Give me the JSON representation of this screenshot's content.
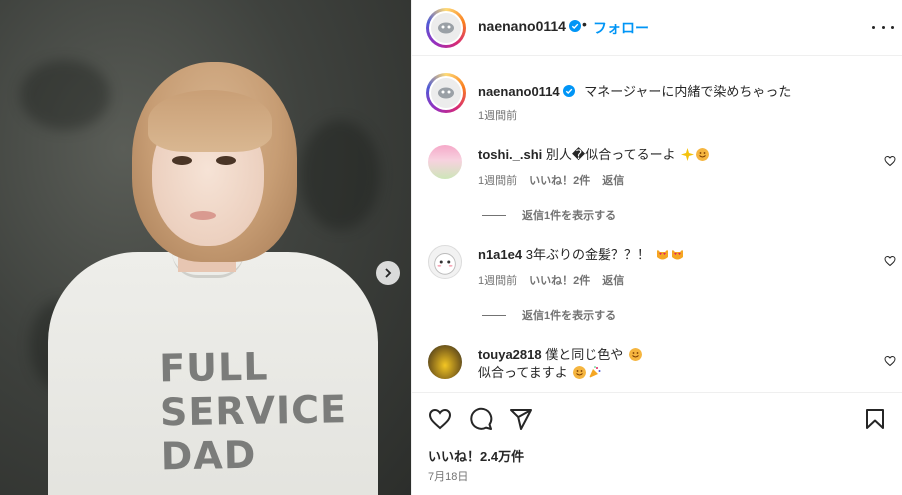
{
  "header": {
    "username": "naenano0114",
    "dot": "•",
    "follow_label": "フォロー"
  },
  "caption": {
    "username": "naenano0114",
    "text": "マネージャーに内緒で染めちゃった",
    "time": "1週間前"
  },
  "comments": [
    {
      "username": "toshi._.shi",
      "text": "別人�似合ってるーよ",
      "emojis": [
        "sparkles",
        "smiling-face"
      ],
      "time": "1週間前",
      "likes": "いいね！2件",
      "reply_label": "返信",
      "view_replies": "返信1件を表示する"
    },
    {
      "username": "n1a1e4",
      "text": "3年ぶりの金髪？？！",
      "emojis": [
        "heart-eyes-cat",
        "heart-eyes-cat"
      ],
      "time": "1週間前",
      "likes": "いいね！2件",
      "reply_label": "返信",
      "view_replies": "返信1件を表示する"
    },
    {
      "username": "touya2818",
      "text_line1": "僕と同じ色や",
      "text_line2": "似合ってますよ",
      "emojis_line1": [
        "smiling-face"
      ],
      "emojis_line2": [
        "smiling-face",
        "party-popper"
      ]
    }
  ],
  "photo": {
    "shirt_print": [
      "FULL",
      "SERVICE",
      "DAD"
    ]
  },
  "footer": {
    "likes": "いいね！2.4万件",
    "date": "7月18日"
  },
  "icons": {
    "like": "heart-icon",
    "comment": "comment-icon",
    "share": "share-icon",
    "save": "bookmark-icon",
    "more": "more-options-icon",
    "next": "chevron-right-icon"
  },
  "colors": {
    "link": "#0095f6",
    "text": "#262626",
    "muted": "#737373",
    "border": "#efefef"
  }
}
